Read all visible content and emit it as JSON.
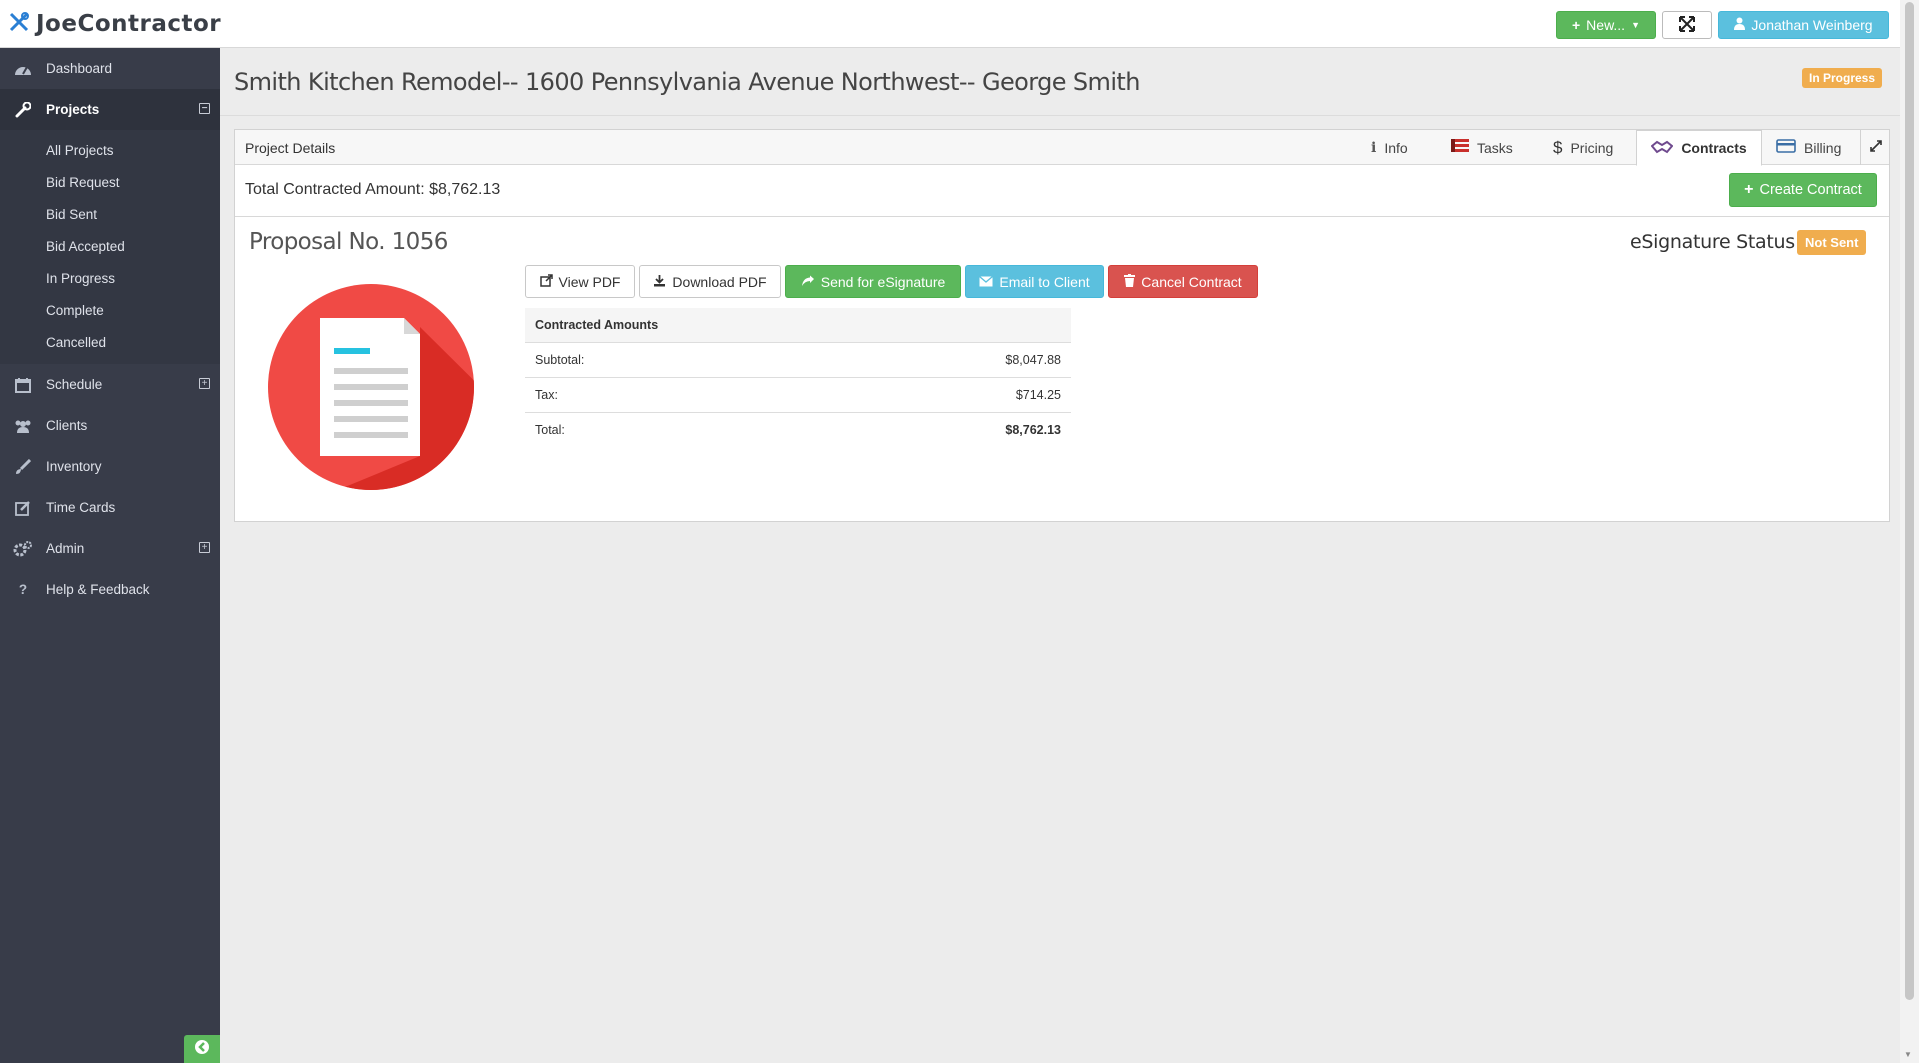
{
  "app": {
    "logo_text": "JoeContractor"
  },
  "topbar": {
    "new_label": "New...",
    "user_label": "Jonathan Weinberg"
  },
  "sidebar": {
    "items": [
      {
        "label": "Dashboard",
        "icon": "dashboard-icon"
      },
      {
        "label": "Projects",
        "icon": "wrench-icon"
      },
      {
        "label": "Schedule",
        "icon": "calendar-icon"
      },
      {
        "label": "Clients",
        "icon": "users-icon"
      },
      {
        "label": "Inventory",
        "icon": "brush-icon"
      },
      {
        "label": "Time Cards",
        "icon": "edit-icon"
      },
      {
        "label": "Admin",
        "icon": "gears-icon"
      },
      {
        "label": "Help & Feedback",
        "icon": "question-icon"
      }
    ],
    "project_subitems": [
      "All Projects",
      "Bid Request",
      "Bid Sent",
      "Bid Accepted",
      "In Progress",
      "Complete",
      "Cancelled"
    ]
  },
  "page": {
    "title": "Smith Kitchen Remodel-- 1600 Pennsylvania Avenue Northwest-- George Smith",
    "status": "In Progress"
  },
  "panel": {
    "title": "Project Details",
    "tabs": [
      {
        "label": "Info",
        "icon": "info-icon"
      },
      {
        "label": "Tasks",
        "icon": "tasks-icon"
      },
      {
        "label": "Pricing",
        "icon": "dollar-icon"
      },
      {
        "label": "Contracts",
        "icon": "handshake-icon",
        "active": true
      },
      {
        "label": "Billing",
        "icon": "credit-card-icon"
      }
    ],
    "total_contracted": "Total Contracted Amount: $8,762.13",
    "create_contract_label": "Create Contract"
  },
  "proposal": {
    "title": "Proposal No. 1056",
    "esignature_label": "eSignature Status:",
    "esignature_status": "Not Sent",
    "actions": {
      "view_pdf": "View PDF",
      "download_pdf": "Download PDF",
      "send_esignature": "Send for eSignature",
      "email_client": "Email to Client",
      "cancel_contract": "Cancel Contract"
    },
    "amounts": {
      "header": "Contracted Amounts",
      "rows": [
        {
          "label": "Subtotal:",
          "value": "$8,047.88"
        },
        {
          "label": "Tax:",
          "value": "$714.25"
        },
        {
          "label": "Total:",
          "value": "$8,762.13"
        }
      ]
    }
  },
  "colors": {
    "success": "#5cb85c",
    "info": "#5bc0de",
    "danger": "#d9534f",
    "warning": "#f0ad4e",
    "sidebar": "#383c49"
  }
}
